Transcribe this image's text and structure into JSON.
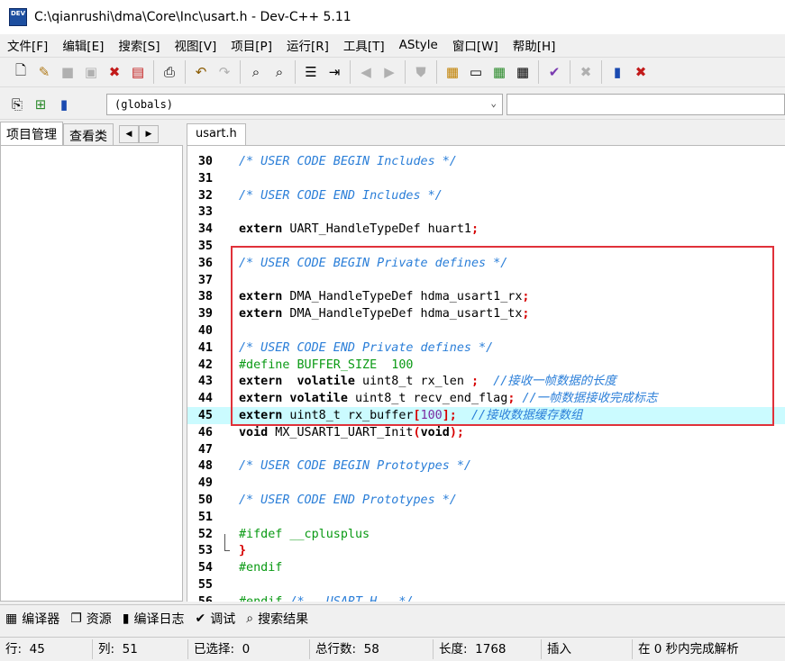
{
  "window": {
    "title": "C:\\qianrushi\\dma\\Core\\Inc\\usart.h - Dev-C++ 5.11",
    "app_icon_label": "DEV"
  },
  "menu": [
    "文件[F]",
    "编辑[E]",
    "搜索[S]",
    "视图[V]",
    "项目[P]",
    "运行[R]",
    "工具[T]",
    "AStyle",
    "窗口[W]",
    "帮助[H]"
  ],
  "toolbar2": {
    "scope_value": "(globals)"
  },
  "left_panel": {
    "tabs": [
      "项目管理",
      "查看类"
    ]
  },
  "editor": {
    "tab": "usart.h",
    "lines": [
      {
        "n": "30",
        "parts": [
          [
            "cm",
            "/* USER CODE BEGIN Includes */"
          ]
        ]
      },
      {
        "n": "31",
        "parts": []
      },
      {
        "n": "32",
        "parts": [
          [
            "cm",
            "/* USER CODE END Includes */"
          ]
        ]
      },
      {
        "n": "33",
        "parts": []
      },
      {
        "n": "34",
        "parts": [
          [
            "kw",
            "extern"
          ],
          [
            "",
            " UART_HandleTypeDef huart1"
          ],
          [
            "sym",
            ";"
          ]
        ]
      },
      {
        "n": "35",
        "parts": []
      },
      {
        "n": "36",
        "parts": [
          [
            "cm",
            "/* USER CODE BEGIN Private defines */"
          ]
        ]
      },
      {
        "n": "37",
        "parts": []
      },
      {
        "n": "38",
        "parts": [
          [
            "kw",
            "extern"
          ],
          [
            "",
            " DMA_HandleTypeDef hdma_usart1_rx"
          ],
          [
            "sym",
            ";"
          ]
        ]
      },
      {
        "n": "39",
        "parts": [
          [
            "kw",
            "extern"
          ],
          [
            "",
            " DMA_HandleTypeDef hdma_usart1_tx"
          ],
          [
            "sym",
            ";"
          ]
        ]
      },
      {
        "n": "40",
        "parts": []
      },
      {
        "n": "41",
        "parts": [
          [
            "cm",
            "/* USER CODE END Private defines */"
          ]
        ]
      },
      {
        "n": "42",
        "parts": [
          [
            "pp",
            "#define BUFFER_SIZE  100"
          ]
        ]
      },
      {
        "n": "43",
        "parts": [
          [
            "kw",
            "extern  volatile"
          ],
          [
            "",
            " uint8_t rx_len "
          ],
          [
            "sym",
            ";"
          ],
          [
            "",
            "  "
          ],
          [
            "cm",
            "//接收一帧数据的长度"
          ]
        ]
      },
      {
        "n": "44",
        "parts": [
          [
            "kw",
            "extern volatile"
          ],
          [
            "",
            " uint8_t recv_end_flag"
          ],
          [
            "sym",
            ";"
          ],
          [
            "",
            " "
          ],
          [
            "cm",
            "//一帧数据接收完成标志"
          ]
        ]
      },
      {
        "n": "45",
        "parts": [
          [
            "kw",
            "extern"
          ],
          [
            "",
            " uint8_t rx_buffer"
          ],
          [
            "sym",
            "["
          ],
          [
            "num",
            "100"
          ],
          [
            "sym",
            "];"
          ],
          [
            "",
            "  "
          ],
          [
            "cm",
            "//接收数据缓存数组"
          ]
        ],
        "current": true
      },
      {
        "n": "46",
        "parts": [
          [
            "kw",
            "void"
          ],
          [
            "",
            " MX_USART1_UART_Init"
          ],
          [
            "sym",
            "("
          ],
          [
            "kw",
            "void"
          ],
          [
            "sym",
            ");"
          ]
        ]
      },
      {
        "n": "47",
        "parts": []
      },
      {
        "n": "48",
        "parts": [
          [
            "cm",
            "/* USER CODE BEGIN Prototypes */"
          ]
        ]
      },
      {
        "n": "49",
        "parts": []
      },
      {
        "n": "50",
        "parts": [
          [
            "cm",
            "/* USER CODE END Prototypes */"
          ]
        ]
      },
      {
        "n": "51",
        "parts": []
      },
      {
        "n": "52",
        "parts": [
          [
            "pp",
            "#ifdef __cplusplus"
          ]
        ]
      },
      {
        "n": "53",
        "parts": [
          [
            "sym",
            "}"
          ]
        ]
      },
      {
        "n": "54",
        "parts": [
          [
            "pp",
            "#endif"
          ]
        ]
      },
      {
        "n": "55",
        "parts": []
      },
      {
        "n": "56",
        "parts": [
          [
            "pp",
            "#endif "
          ],
          [
            "cm",
            "/* __USART_H__ */"
          ]
        ]
      }
    ]
  },
  "bottom_tabs": [
    {
      "icon": "compiler-icon",
      "glyph": "▦",
      "label": "编译器"
    },
    {
      "icon": "resources-icon",
      "glyph": "❐",
      "label": "资源"
    },
    {
      "icon": "compile-log-icon",
      "glyph": "▮",
      "label": "编译日志"
    },
    {
      "icon": "debug-icon",
      "glyph": "✔",
      "label": "调试"
    },
    {
      "icon": "search-results-icon",
      "glyph": "⌕",
      "label": "搜索结果"
    }
  ],
  "status": {
    "line_label": "行:",
    "line_value": "45",
    "col_label": "列:",
    "col_value": "51",
    "sel_label": "已选择:",
    "sel_value": "0",
    "total_label": "总行数:",
    "total_value": "58",
    "len_label": "长度:",
    "len_value": "1768",
    "mode": "插入",
    "parse_msg": "在 0 秒内完成解析"
  },
  "colors": {
    "comment": "#2a7ed8",
    "preprocessor": "#0a9a14",
    "symbol": "#d60000",
    "number": "#7b2aa0",
    "current_line": "#cbfbff",
    "highlight_box": "#e0313a"
  }
}
